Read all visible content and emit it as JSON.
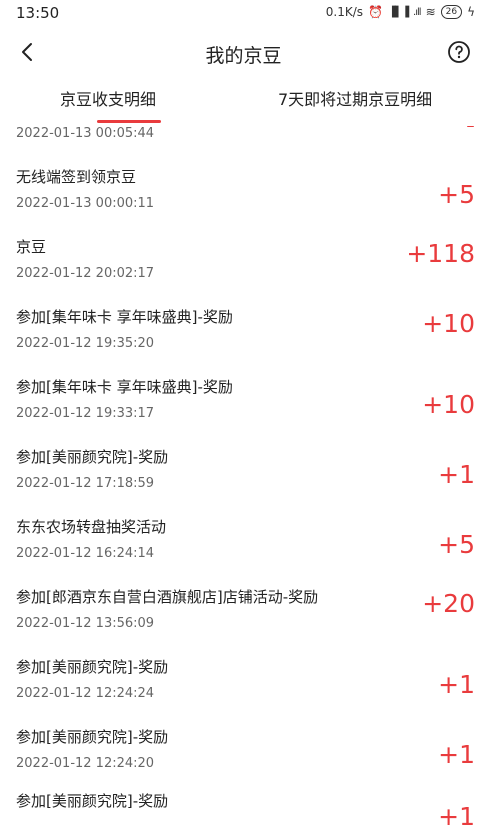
{
  "status": {
    "time": "13:50",
    "net_speed": "0.1K/s",
    "signal_1": "▐▌▐",
    "signal_2": ".ıll",
    "battery": "26"
  },
  "nav": {
    "title": "我的京豆",
    "back_icon": "chevron-left-icon",
    "help_icon": "question-circle-icon"
  },
  "tabs": [
    {
      "label": "京豆收支明细",
      "active": true
    },
    {
      "label": "7天即将过期京豆明细",
      "active": false
    }
  ],
  "accent_color": "#e93b3d",
  "records": [
    {
      "title": "",
      "date": "2022-01-13 00:05:44",
      "amount": "-"
    },
    {
      "title": "无线端签到领京豆",
      "date": "2022-01-13 00:00:11",
      "amount": "+5"
    },
    {
      "title": "京豆",
      "date": "2022-01-12 20:02:17",
      "amount": "+118"
    },
    {
      "title": "参加[集年味卡 享年味盛典]-奖励",
      "date": "2022-01-12 19:35:20",
      "amount": "+10"
    },
    {
      "title": "参加[集年味卡 享年味盛典]-奖励",
      "date": "2022-01-12 19:33:17",
      "amount": "+10"
    },
    {
      "title": "参加[美丽颜究院]-奖励",
      "date": "2022-01-12 17:18:59",
      "amount": "+1"
    },
    {
      "title": "东东农场转盘抽奖活动",
      "date": "2022-01-12 16:24:14",
      "amount": "+5"
    },
    {
      "title": "参加[郎酒京东自营白酒旗舰店]店铺活动-奖励",
      "date": "2022-01-12 13:56:09",
      "amount": "+20"
    },
    {
      "title": "参加[美丽颜究院]-奖励",
      "date": "2022-01-12 12:24:24",
      "amount": "+1"
    },
    {
      "title": "参加[美丽颜究院]-奖励",
      "date": "2022-01-12 12:24:20",
      "amount": "+1"
    },
    {
      "title": "参加[美丽颜究院]-奖励",
      "date": "",
      "amount": "+1"
    }
  ]
}
